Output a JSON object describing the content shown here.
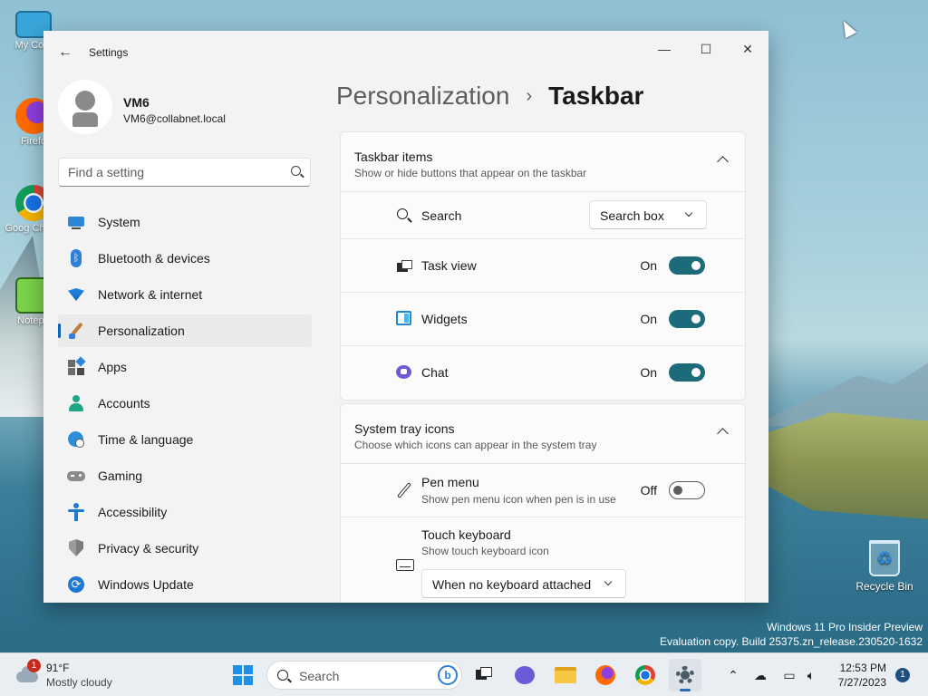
{
  "desktop": {
    "icons": [
      "My Com",
      "Firefo",
      "Goog Chrom",
      "Notepa"
    ],
    "recycle_bin": "Recycle Bin",
    "watermark_line1": "Windows 11 Pro Insider Preview",
    "watermark_line2": "Evaluation copy. Build 25375.zn_release.230520-1632"
  },
  "window": {
    "app_title": "Settings",
    "minimize_glyph": "—",
    "maximize_glyph": "☐",
    "close_glyph": "✕"
  },
  "profile": {
    "name": "VM6",
    "email": "VM6@collabnet.local"
  },
  "search": {
    "placeholder": "Find a setting"
  },
  "nav": {
    "items": [
      {
        "label": "System",
        "icon": "monitor-icon"
      },
      {
        "label": "Bluetooth & devices",
        "icon": "bluetooth-icon"
      },
      {
        "label": "Network & internet",
        "icon": "wifi-icon"
      },
      {
        "label": "Personalization",
        "icon": "brush-icon",
        "active": true
      },
      {
        "label": "Apps",
        "icon": "apps-icon"
      },
      {
        "label": "Accounts",
        "icon": "person-icon"
      },
      {
        "label": "Time & language",
        "icon": "globe-clock-icon"
      },
      {
        "label": "Gaming",
        "icon": "gamepad-icon"
      },
      {
        "label": "Accessibility",
        "icon": "accessibility-icon"
      },
      {
        "label": "Privacy & security",
        "icon": "shield-icon"
      },
      {
        "label": "Windows Update",
        "icon": "update-icon"
      }
    ]
  },
  "breadcrumb": {
    "parent": "Personalization",
    "separator": "›",
    "current": "Taskbar"
  },
  "taskbar_items": {
    "title": "Taskbar items",
    "subtitle": "Show or hide buttons that appear on the taskbar",
    "rows": {
      "search": {
        "label": "Search",
        "value": "Search box"
      },
      "task_view": {
        "label": "Task view",
        "state": "On",
        "enabled": true
      },
      "widgets": {
        "label": "Widgets",
        "state": "On",
        "enabled": true
      },
      "chat": {
        "label": "Chat",
        "state": "On",
        "enabled": true
      }
    }
  },
  "system_tray": {
    "title": "System tray icons",
    "subtitle": "Choose which icons can appear in the system tray",
    "rows": {
      "pen_menu": {
        "label": "Pen menu",
        "desc": "Show pen menu icon when pen is in use",
        "state": "Off",
        "enabled": false
      },
      "touch_keyboard": {
        "label": "Touch keyboard",
        "desc": "Show touch keyboard icon",
        "value": "When no keyboard attached"
      }
    }
  },
  "taskbar": {
    "weather_temp": "91°F",
    "weather_desc": "Mostly cloudy",
    "weather_badge": "1",
    "search_label": "Search",
    "bing_glyph": "b",
    "time": "12:53 PM",
    "date": "7/27/2023",
    "notification_count": "1"
  },
  "colors": {
    "accent": "#1d6a7a",
    "nav_indicator": "#0a63b5",
    "window_bg": "#f3f3f3"
  }
}
